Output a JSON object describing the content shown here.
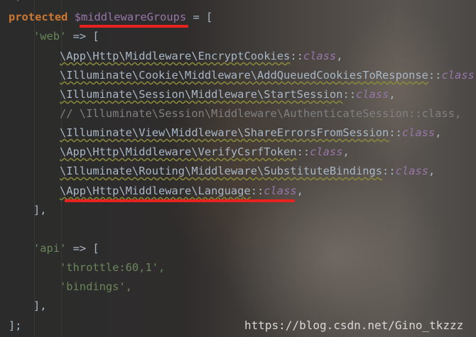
{
  "code": {
    "line0": {
      "keyword": "protected",
      "variable": "$middlewareGroups",
      "rest": " = ["
    },
    "line1": {
      "key": "'web'",
      "rest": " => ["
    },
    "web_items": [
      {
        "path": "\\App\\Http\\Middleware\\EncryptCookies",
        "sep": "::",
        "kw": "class",
        "end": ","
      },
      {
        "path": "\\Illuminate\\Cookie\\Middleware\\AddQueuedCookiesToResponse",
        "sep": "::",
        "kw": "class",
        "end": ","
      },
      {
        "path": "\\Illuminate\\Session\\Middleware\\StartSession",
        "sep": "::",
        "kw": "class",
        "end": ","
      }
    ],
    "comment_line": "// \\Illuminate\\Session\\Middleware\\AuthenticateSession::class,",
    "web_items_2": [
      {
        "path": "\\Illuminate\\View\\Middleware\\ShareErrorsFromSession",
        "sep": "::",
        "kw": "class",
        "end": ","
      },
      {
        "path": "\\App\\Http\\Middleware\\VerifyCsrfToken",
        "sep": "::",
        "kw": "class",
        "end": ","
      },
      {
        "path": "\\Illuminate\\Routing\\Middleware\\SubstituteBindings",
        "sep": "::",
        "kw": "class",
        "end": ","
      },
      {
        "path": "\\App\\Http\\Middleware\\Language",
        "sep": "::",
        "kw": "class",
        "end": ","
      }
    ],
    "close_web": "],",
    "line_api": {
      "key": "'api'",
      "rest": " => ["
    },
    "api_items": [
      "'throttle:60,1',",
      "'bindings',"
    ],
    "close_api": "],",
    "close_all": "];"
  },
  "watermark": "https://blog.csdn.net/Gino_tkzzz",
  "colors": {
    "keyword": "#cc7832",
    "variable": "#9876aa",
    "string": "#6a8759",
    "comment": "#808080",
    "text": "#a9b7c6",
    "highlight_underline": "#e8221f"
  }
}
